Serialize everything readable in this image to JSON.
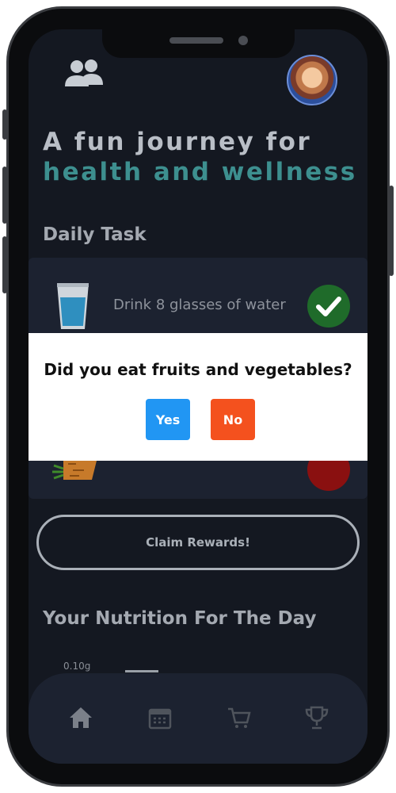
{
  "header": {
    "users_icon": "users-icon",
    "avatar": "profile-avatar"
  },
  "hero": {
    "line1": "A fun journey for",
    "line2": "health and wellness"
  },
  "daily_task": {
    "heading": "Daily Task",
    "tasks": [
      {
        "label": "Drink 8 glasses of water",
        "icon": "water-glass-icon",
        "status": "done"
      },
      {
        "label": "",
        "icon": "carrot-icon",
        "status": "not-done"
      }
    ]
  },
  "dialog": {
    "question": "Did you eat fruits and vegetables?",
    "yes_label": "Yes",
    "no_label": "No"
  },
  "claim_button": "Claim Rewards!",
  "nutrition": {
    "heading": "Your Nutrition For The Day",
    "value_label": "0.10g"
  },
  "nav": {
    "items": [
      "home-icon",
      "calendar-icon",
      "cart-icon",
      "trophy-icon"
    ]
  },
  "colors": {
    "background": "#141821",
    "accent_teal": "#3d8f8f",
    "yes": "#2196f3",
    "no": "#f4511e",
    "done": "#1f6b2a"
  }
}
